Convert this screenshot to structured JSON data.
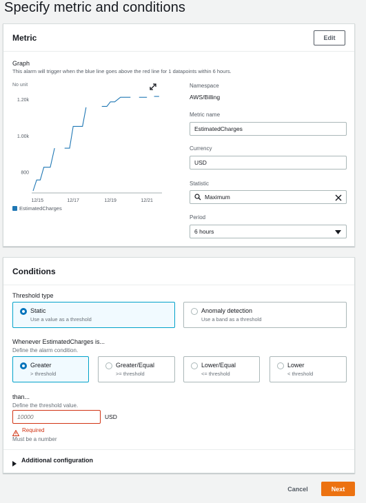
{
  "page": {
    "title": "Specify metric and conditions"
  },
  "metric": {
    "panel_title": "Metric",
    "edit_label": "Edit",
    "graph_label": "Graph",
    "graph_desc": "This alarm will trigger when the blue line goes above the red line for 1 datapoints within 6 hours.",
    "namespace_label": "Namespace",
    "namespace_value": "AWS/Billing",
    "metric_name_label": "Metric name",
    "metric_name_value": "EstimatedCharges",
    "currency_label": "Currency",
    "currency_value": "USD",
    "statistic_label": "Statistic",
    "statistic_value": "Maximum",
    "period_label": "Period",
    "period_value": "6 hours"
  },
  "chart_data": {
    "type": "line",
    "unit_label": "No unit",
    "y_ticks": [
      "1.20k",
      "1.00k",
      "800"
    ],
    "x_ticks": [
      "12/15",
      "12/17",
      "12/19",
      "12/21"
    ],
    "legend": "EstimatedCharges",
    "series_color": "#1f77b4",
    "series": [
      {
        "name": "EstimatedCharges",
        "segments": [
          [
            [
              0,
              700
            ],
            [
              0.5,
              760
            ],
            [
              1.0,
              760
            ],
            [
              1.5,
              830
            ],
            [
              2.4,
              830
            ],
            [
              3.0,
              935
            ]
          ],
          [
            [
              4.4,
              935
            ],
            [
              5.1,
              935
            ],
            [
              5.6,
              1055
            ],
            [
              6.9,
              1055
            ],
            [
              7.4,
              1160
            ]
          ],
          [
            [
              9.6,
              1165
            ],
            [
              10.3,
              1165
            ],
            [
              10.8,
              1190
            ],
            [
              11.4,
              1190
            ],
            [
              12.2,
              1215
            ],
            [
              13.6,
              1215
            ]
          ],
          [
            [
              14.8,
              1215
            ],
            [
              15.9,
              1215
            ]
          ],
          [
            [
              16.9,
              1220
            ],
            [
              17.6,
              1220
            ]
          ]
        ]
      }
    ],
    "ylim": [
      700,
      1250
    ]
  },
  "conditions": {
    "panel_title": "Conditions",
    "threshold_type_label": "Threshold type",
    "static_title": "Static",
    "static_desc": "Use a value as a threshold",
    "anomaly_title": "Anomaly detection",
    "anomaly_desc": "Use a band as a threshold",
    "whenever_label": "Whenever EstimatedCharges is...",
    "whenever_desc": "Define the alarm condition.",
    "greater_title": "Greater",
    "greater_desc": "> threshold",
    "greater_eq_title": "Greater/Equal",
    "greater_eq_desc": ">= threshold",
    "lower_eq_title": "Lower/Equal",
    "lower_eq_desc": "<= threshold",
    "lower_title": "Lower",
    "lower_desc": "< threshold",
    "than_label": "than...",
    "than_desc": "Define the threshold value.",
    "threshold_placeholder": "10000",
    "threshold_unit": "USD",
    "error_required": "Required",
    "error_desc": "Must be a number",
    "additional_config": "Additional configuration"
  },
  "footer": {
    "cancel_label": "Cancel",
    "next_label": "Next"
  }
}
